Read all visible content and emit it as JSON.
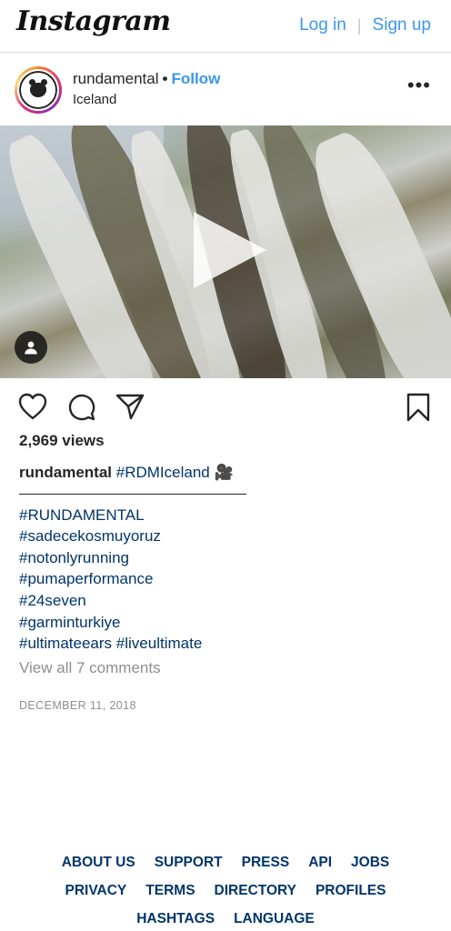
{
  "topbar": {
    "logo": "Instagram",
    "login_label": "Log in",
    "separator": "|",
    "signup_label": "Sign up",
    "accent_color": "#3897f0"
  },
  "post": {
    "username": "rundamental",
    "dot": "•",
    "follow_label": "Follow",
    "location": "Iceland",
    "more_icon": "more-horizontal-icon",
    "media": {
      "type": "video",
      "play_icon": "play-icon",
      "user_tag_icon": "user-tag-icon"
    },
    "actions": {
      "like_icon": "heart-icon",
      "comment_icon": "comment-icon",
      "share_icon": "share-icon",
      "save_icon": "bookmark-icon"
    },
    "views": "2,969 views",
    "caption": {
      "username": "rundamental",
      "first_tag": "#RDMIceland",
      "emoji": "🎥",
      "separator_line": "___________________________",
      "tags": [
        "#RUNDAMENTAL",
        "#sadecekosmuyoruz",
        "#notonlyrunning",
        "#pumaperformance",
        "#24seven",
        "#garminturkiye"
      ],
      "last_line_tags": [
        "#ultimateears",
        "#liveultimate"
      ]
    },
    "view_comments_label": "View all 7 comments",
    "date": "DECEMBER 11, 2018"
  },
  "footer": {
    "row1": [
      "ABOUT US",
      "SUPPORT",
      "PRESS",
      "API",
      "JOBS"
    ],
    "row2": [
      "PRIVACY",
      "TERMS",
      "DIRECTORY",
      "PROFILES"
    ],
    "row3": [
      "HASHTAGS",
      "LANGUAGE"
    ]
  }
}
